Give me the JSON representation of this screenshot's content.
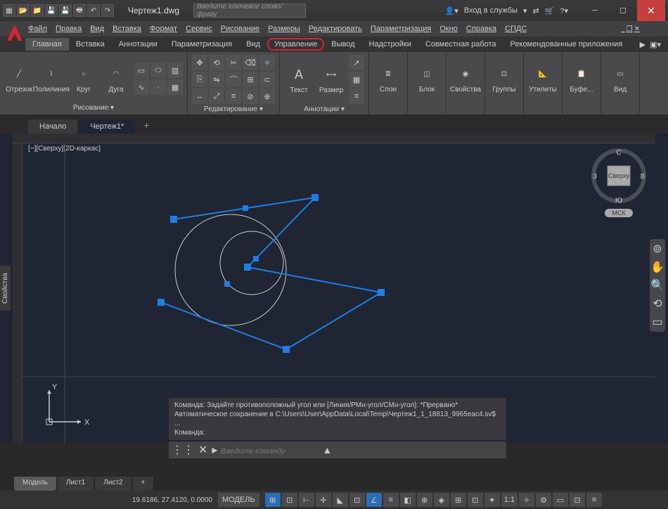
{
  "title": "Чертеж1.dwg",
  "search_placeholder": "Введите ключевое слово/фразу",
  "login_label": "Вход в службы",
  "menu": [
    "Файл",
    "Правка",
    "Вид",
    "Вставка",
    "Формат",
    "Сервис",
    "Рисование",
    "Размеры",
    "Редактировать",
    "Параметризация",
    "Окно",
    "Справка",
    "СПДС"
  ],
  "ribbon_tabs": [
    "Главная",
    "Вставка",
    "Аннотации",
    "Параметризация",
    "Вид",
    "Управление",
    "Вывод",
    "Надстройки",
    "Совместная работа",
    "Рекомендованные приложения"
  ],
  "ribbon_active": 0,
  "ribbon_highlight": 5,
  "panels": {
    "draw": {
      "title": "Рисование ▾",
      "tools": [
        "Отрезок",
        "Полилиния",
        "Круг",
        "Дуга"
      ]
    },
    "modify": {
      "title": "Редактирование ▾"
    },
    "annot": {
      "title": "Аннотации ▾",
      "tools": [
        "Текст",
        "Размер"
      ]
    },
    "layers": {
      "title": "Слои"
    },
    "block": {
      "title": "Блок"
    },
    "props": {
      "title": "Свойства"
    },
    "groups": {
      "title": "Группы"
    },
    "utils": {
      "title": "Утилиты"
    },
    "clip": {
      "title": "Буфе..."
    },
    "view": {
      "title": "Вид"
    }
  },
  "filetabs": {
    "start": "Начало",
    "active": "Чертеж1*"
  },
  "view_label": "[−][Сверху][2D-каркас]",
  "viewcube": {
    "top": "Сверху",
    "n": "С",
    "s": "Ю",
    "e": "В",
    "w": "З",
    "cs": "МСК"
  },
  "props_tab": "Свойства",
  "ucs": {
    "x": "X",
    "y": "Y"
  },
  "cmd_history": [
    "Команда: Задайте противоположный угол или [Линия/РМн-угол/СМн-угол]: *Прервано*",
    "Автоматическое сохранение в C:\\Users\\User\\AppData\\Local\\Temp\\Чертеж1_1_18813_9965eac4.sv$ ...",
    "Команда:"
  ],
  "cmd_placeholder": "Введите команду",
  "layout_tabs": [
    "Модель",
    "Лист1",
    "Лист2"
  ],
  "status": {
    "coords": "19.6186, 27.4120, 0.0000",
    "model": "МОДЕЛЬ",
    "scale": "1:1"
  }
}
